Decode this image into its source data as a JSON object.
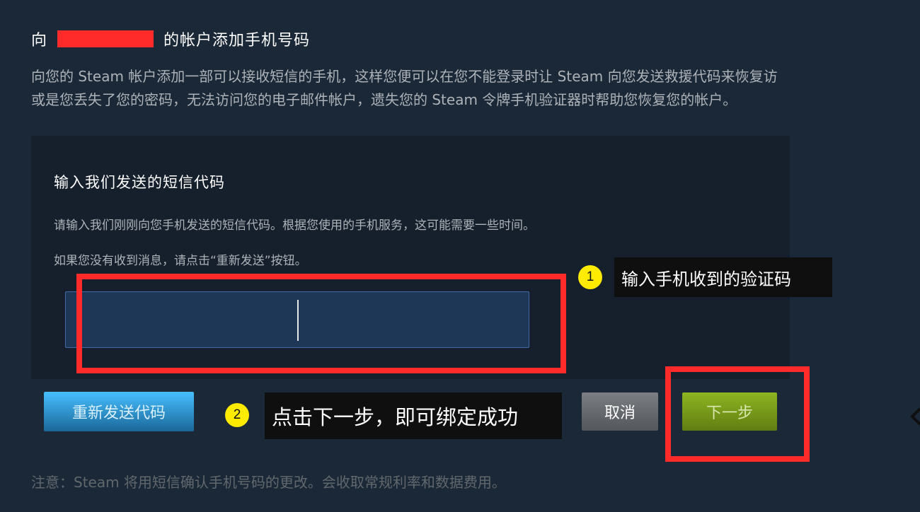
{
  "header": {
    "title_prefix": "向",
    "title_suffix": "的帐户添加手机号码"
  },
  "intro": {
    "line1": "向您的 Steam 帐户添加一部可以接收短信的手机，这样您便可以在您不能登录时让 Steam 向您发送救援代码来恢复访",
    "line2": "或是您丢失了您的密码，无法访问您的电子邮件帐户，遗失您的 Steam 令牌手机验证器时帮助您恢复您的帐户。"
  },
  "code_panel": {
    "heading": "输入我们发送的短信代码",
    "desc1": "请输入我们刚刚向您手机发送的短信代码。根据您使用的手机服务，这可能需要一些时间。",
    "desc2": "如果您没有收到消息，请点击“重新发送”按钮。",
    "input_value": ""
  },
  "buttons": {
    "resend": "重新发送代码",
    "cancel": "取消",
    "next": "下一步"
  },
  "annotations": {
    "step1_number": "1",
    "step1_text": "输入手机收到的验证码",
    "step2_number": "2",
    "step2_text": "点击下一步，即可绑定成功"
  },
  "footer": {
    "note": "注意：Steam 将用短信确认手机号码的更改。会收取常规利率和数据费用。"
  },
  "colors": {
    "background": "#1b2838",
    "panel": "#16202d",
    "annotation_red": "#ff2b2b",
    "badge_yellow": "#ffeb00",
    "next_green": "#7ea31a",
    "resend_blue": "#2f8fd1"
  }
}
